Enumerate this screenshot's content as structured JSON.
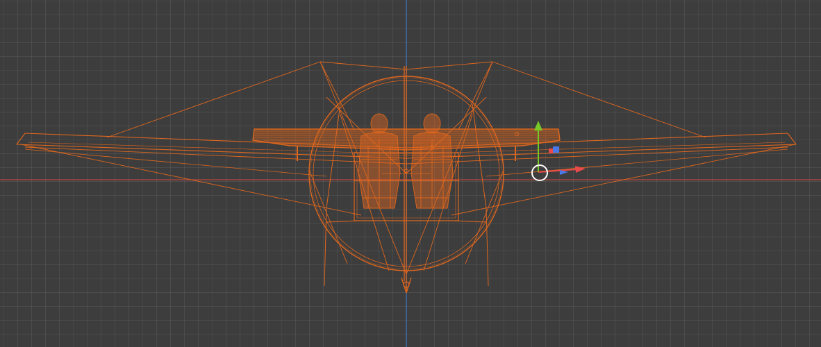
{
  "viewport": {
    "mode": "wireframe",
    "object": "biplane",
    "background_color": "#3d3d3d",
    "selected_wire_color": "#e0671e",
    "axis_x_color": "#b84a3f",
    "axis_z_color": "#3a6fc4"
  },
  "gizmo": {
    "y_axis_color": "#78c928",
    "x_axis_color": "#e84a4a",
    "z_axis_color": "#4a78e8",
    "pivot_ring_color": "#ffffff"
  }
}
